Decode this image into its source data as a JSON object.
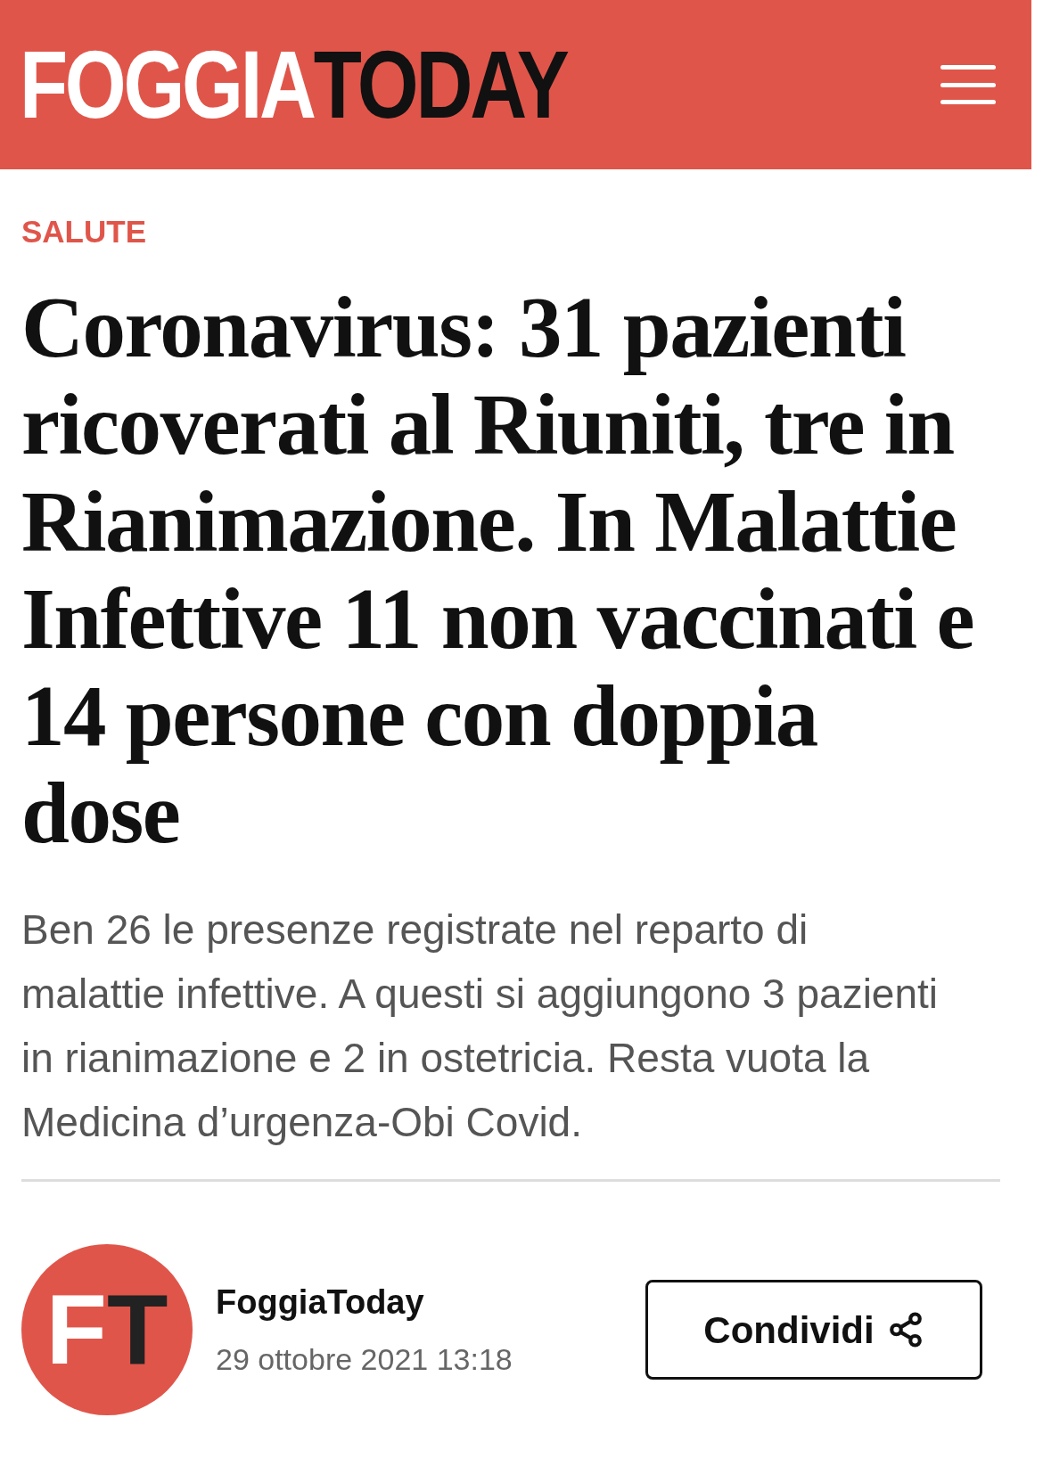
{
  "header": {
    "logo_first": "FOGGIA",
    "logo_second": "TODAY"
  },
  "article": {
    "category": "SALUTE",
    "title": "Coronavirus: 31 pazienti ricoverati al Riuniti, tre in Rianimazione. In Malattie Infettive 11 non vaccinati e 14 persone con doppia dose",
    "summary": "Ben 26 le presenze registrate nel reparto di malattie infettive. A questi si aggiungono 3 pazienti in rianimazione e 2 in ostetricia. Resta vuota la Medicina d’urgenza-Obi Covid."
  },
  "author": {
    "avatar_first": "F",
    "avatar_second": "T",
    "name": "FoggiaToday",
    "date": "29 ottobre 2021 13:18"
  },
  "share_button": {
    "label": "Condividi"
  }
}
